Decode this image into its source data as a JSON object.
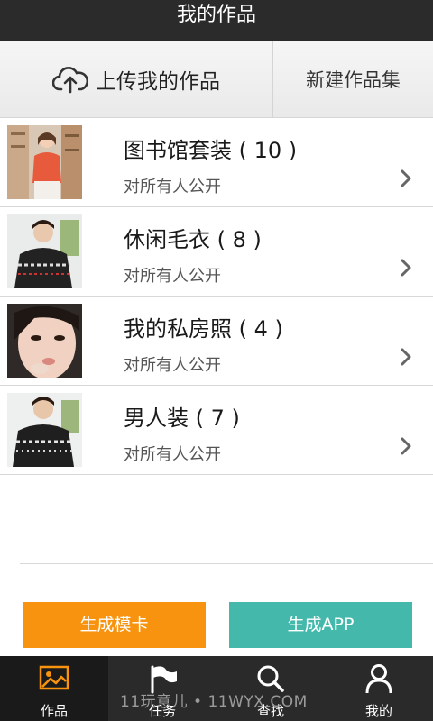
{
  "header": {
    "title": "我的作品"
  },
  "actions": {
    "upload_label": "上传我的作品",
    "new_set_label": "新建作品集"
  },
  "albums": [
    {
      "title": "图书馆套装 ( 10 )",
      "visibility": "对所有人公开"
    },
    {
      "title": "休闲毛衣 ( 8 )",
      "visibility": "对所有人公开"
    },
    {
      "title": "我的私房照 ( 4 )",
      "visibility": "对所有人公开"
    },
    {
      "title": "男人装 ( 7 )",
      "visibility": "对所有人公开"
    }
  ],
  "buttons": {
    "model_card": "生成模卡",
    "app": "生成APP",
    "model_card_color": "#f7930f",
    "app_color": "#45b8ac"
  },
  "tabs": [
    {
      "label": "作品",
      "icon": "image-icon",
      "active": true
    },
    {
      "label": "任务",
      "icon": "flag-icon",
      "active": false
    },
    {
      "label": "查找",
      "icon": "search-icon",
      "active": false
    },
    {
      "label": "我的",
      "icon": "user-icon",
      "active": false
    }
  ],
  "watermark": "11玩意儿 • 11WYX.COM",
  "colors": {
    "accent": "#f7930f",
    "tab_icon_active": "#f7930f",
    "header_bg": "#2b2b2b"
  }
}
